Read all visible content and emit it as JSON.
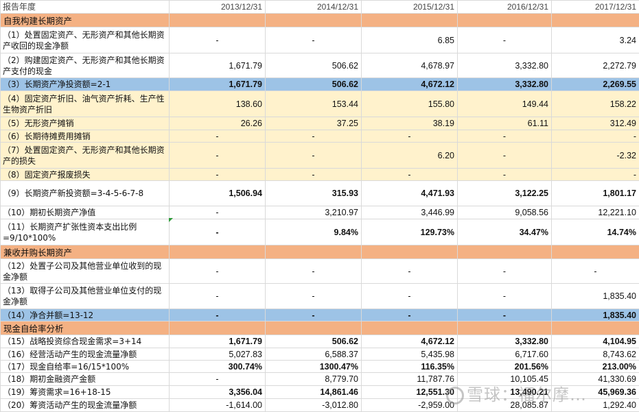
{
  "header": {
    "label": "报告年度",
    "years": [
      "2013/12/31",
      "2014/12/31",
      "2015/12/31",
      "2016/12/31",
      "2017/12/31"
    ]
  },
  "sections": {
    "self_build": "自我构建长期资产",
    "acquisition": "兼收并购长期资产",
    "self_sufficiency": "现金自给率分析"
  },
  "rows": [
    {
      "label": "（1）处置固定资产、无形资产和其他长期资产收回的现金净额",
      "values": [
        "-",
        "-",
        "6.85",
        "-",
        "3.24"
      ]
    },
    {
      "label": "（2）购建固定资产、无形资产和其他长期资产支付的现金",
      "values": [
        "1,671.79",
        "506.62",
        "4,678.97",
        "3,332.80",
        "2,272.79"
      ]
    },
    {
      "label": "（3）长期资产净投资额=2-1",
      "values": [
        "1,671.79",
        "506.62",
        "4,672.12",
        "3,332.80",
        "2,269.55"
      ]
    },
    {
      "label": "（4）固定资产折旧、油气资产折耗、生产性生物资产折旧",
      "values": [
        "138.60",
        "153.44",
        "155.80",
        "149.44",
        "158.22"
      ]
    },
    {
      "label": "（5）无形资产摊销",
      "values": [
        "26.26",
        "37.25",
        "38.19",
        "61.11",
        "312.49"
      ]
    },
    {
      "label": "（6）长期待摊费用摊销",
      "values": [
        "-",
        "-",
        "-",
        "-",
        "-"
      ]
    },
    {
      "label": "（7）处置固定资产、无形资产和其他长期资产的损失",
      "values": [
        "-",
        "-",
        "6.20",
        "-",
        "-2.32"
      ]
    },
    {
      "label": "（8）固定资产报废损失",
      "values": [
        "-",
        "-",
        "-",
        "-",
        "-"
      ]
    },
    {
      "label": "（9）长期资产新投资额=3-4-5-6-7-8",
      "values": [
        "1,506.94",
        "315.93",
        "4,471.93",
        "3,122.25",
        "1,801.17"
      ]
    },
    {
      "label": "（10）期初长期资产净值",
      "values": [
        "-",
        "3,210.97",
        "3,446.99",
        "9,058.56",
        "12,221.10"
      ]
    },
    {
      "label": "（11）长期资产扩张性资本支出比例=9/10*100%",
      "values": [
        "-",
        "9.84%",
        "129.73%",
        "34.47%",
        "14.74%"
      ]
    },
    {
      "label": "（12）处置子公司及其他营业单位收到的现金净额",
      "values": [
        "-",
        "-",
        "-",
        "-",
        "-"
      ]
    },
    {
      "label": "（13）取得子公司及其他营业单位支付的现金净额",
      "values": [
        "-",
        "-",
        "-",
        "-",
        "1,835.40"
      ]
    },
    {
      "label": "（14）净合并额=13-12",
      "values": [
        "-",
        "-",
        "-",
        "-",
        "1,835.40"
      ]
    },
    {
      "label": "（15）战略投资综合现金需求=3+14",
      "values": [
        "1,671.79",
        "506.62",
        "4,672.12",
        "3,332.80",
        "4,104.95"
      ]
    },
    {
      "label": "（16）经营活动产生的现金流量净额",
      "values": [
        "5,027.83",
        "6,588.37",
        "5,435.98",
        "6,717.60",
        "8,743.62"
      ]
    },
    {
      "label": "（17）现金自给率=16/15*100%",
      "values": [
        "300.74%",
        "1300.47%",
        "116.35%",
        "201.56%",
        "213.00%"
      ]
    },
    {
      "label": "（18）期初金融资产金额",
      "values": [
        "-",
        "8,779.70",
        "11,787.76",
        "10,105.45",
        "41,330.69"
      ]
    },
    {
      "label": "（19）筹资需求=16+18-15",
      "values": [
        "3,356.04",
        "14,861.46",
        "12,551.30",
        "13,490.21",
        "45,969.36"
      ]
    },
    {
      "label": "（20）筹资活动产生的现金流量净额",
      "values": [
        "-1,614.00",
        "-3,012.80",
        "-2,959.00",
        "28,085.87",
        "1,292.40"
      ]
    }
  ],
  "watermark": "雪球：福尔摩…"
}
